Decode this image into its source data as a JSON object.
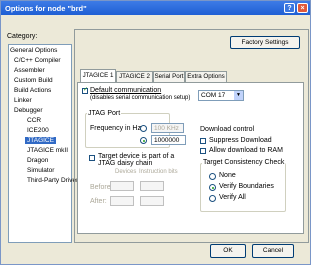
{
  "window": {
    "title": "Options for node \"brd\"",
    "help": "?",
    "close": "×"
  },
  "category": {
    "label": "Category:",
    "items": [
      "General Options",
      "C/C++ Compiler",
      "Assembler",
      "Custom Build",
      "Build Actions",
      "Linker",
      "Debugger",
      "CCR",
      "ICE200",
      "JTAGICE",
      "JTAGICE mkII",
      "Dragon",
      "Simulator",
      "Third-Party Driver"
    ]
  },
  "buttons": {
    "factory": "Factory Settings",
    "ok": "OK",
    "cancel": "Cancel"
  },
  "tabs": [
    "JTAGICE 1",
    "JTAGICE 2",
    "Serial Port",
    "Extra Options"
  ],
  "comm": {
    "checkbox": "Default communication",
    "note": "(disables serial communication setup)",
    "port": "COM 17"
  },
  "jtag": {
    "group": "JTAG Port",
    "freq_label": "Frequency in Hz:",
    "freq_preset": "100 KHz",
    "freq_value": "1000000"
  },
  "daisy": {
    "checkbox_line1": "Target device is part of a",
    "checkbox_line2": "JTAG daisy chain",
    "devices": "Devices",
    "instruction": "Instruction bits",
    "before": "Before:",
    "after": "After:"
  },
  "download": {
    "group": "Download control",
    "suppress": "Suppress Download",
    "ram": "Allow download to RAM"
  },
  "consistency": {
    "group": "Target Consistency Check",
    "none": "None",
    "verify_boundaries": "Verify Boundaries",
    "verify_all": "Verify All"
  }
}
